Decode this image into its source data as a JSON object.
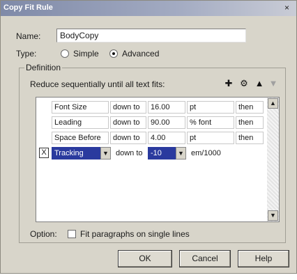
{
  "window": {
    "title": "Copy Fit Rule",
    "close_symbol": "×"
  },
  "name": {
    "label": "Name:",
    "value": "BodyCopy"
  },
  "type": {
    "label": "Type:",
    "options": [
      "Simple",
      "Advanced"
    ],
    "selected": "Advanced"
  },
  "definition": {
    "group_label": "Definition",
    "instruction": "Reduce sequentially until all text fits:",
    "toolbar_icons": [
      "add-icon",
      "gear-icon",
      "arrow-up-icon",
      "arrow-down-icon"
    ],
    "rows": [
      {
        "attribute": "Font Size",
        "down_to": "down to",
        "value": "16.00",
        "unit": "pt",
        "then": "then"
      },
      {
        "attribute": "Leading",
        "down_to": "down to",
        "value": "90.00",
        "unit": "% font",
        "then": "then"
      },
      {
        "attribute": "Space Before",
        "down_to": "down to",
        "value": "4.00",
        "unit": "pt",
        "then": "then"
      },
      {
        "attribute": "Tracking",
        "down_to": "down to",
        "value": "-10",
        "unit": "em/1000",
        "then": ""
      }
    ],
    "delete_symbol": "X"
  },
  "option": {
    "label": "Option:",
    "checkbox_label": "Fit paragraphs on single lines",
    "checked": false
  },
  "buttons": {
    "ok": "OK",
    "cancel": "Cancel",
    "help": "Help"
  }
}
